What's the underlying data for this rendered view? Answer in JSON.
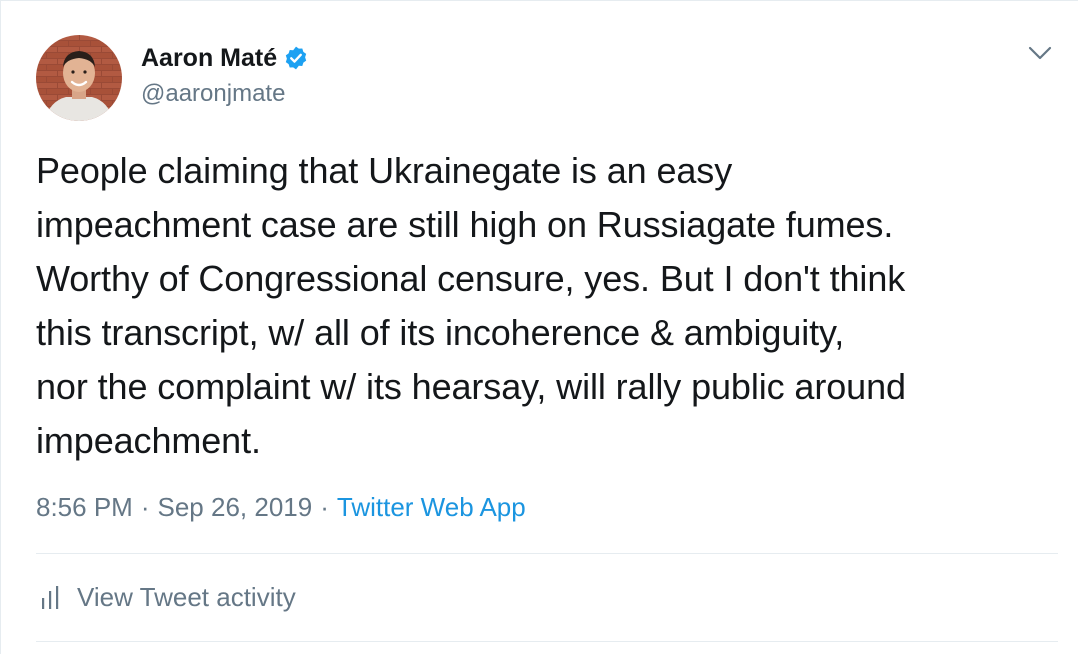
{
  "author": {
    "display_name": "Aaron Maté",
    "handle": "@aaronjmate",
    "verified": true
  },
  "tweet": {
    "text": "People claiming that Ukrainegate is an easy\nimpeachment case are still high on Russiagate fumes.\nWorthy of Congressional censure, yes. But I don't think\nthis transcript, w/ all of its incoherence & ambiguity,\nnor the complaint w/ its hearsay, will rally public around\nimpeachment.",
    "time": "8:56 PM",
    "date": "Sep 26, 2019",
    "separator": "·",
    "source": "Twitter Web App"
  },
  "actions": {
    "view_activity": "View Tweet activity"
  },
  "icons": {
    "verified": "verified-badge-icon",
    "caret": "chevron-down-icon",
    "activity": "bar-chart-icon",
    "avatar": "profile-photo"
  },
  "colors": {
    "text_primary": "#14171a",
    "text_secondary": "#657786",
    "link_blue": "#1b95e0",
    "verified_blue": "#1da1f2",
    "divider": "#e6ecf0"
  }
}
